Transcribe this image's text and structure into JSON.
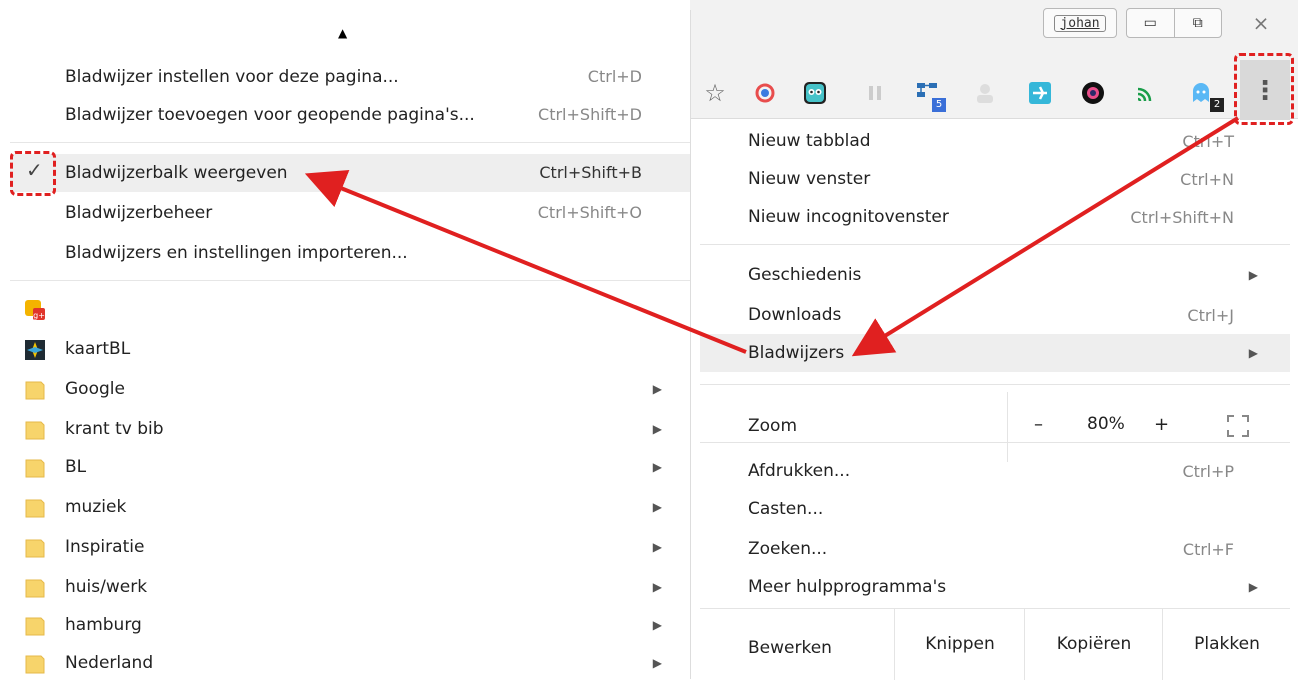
{
  "window": {
    "user_label": "johan",
    "minimize_symbol": "▭",
    "restore_symbol": "⧉",
    "close_symbol": "⨯"
  },
  "toolbar": {
    "star_symbol": "☆",
    "menu_symbol": "⋮",
    "extensions": [
      {
        "name": "b-icon",
        "badge": ""
      },
      {
        "name": "mask-icon",
        "badge": ""
      },
      {
        "name": "pause-icon",
        "badge": ""
      },
      {
        "name": "diagram-icon",
        "badge": "5"
      },
      {
        "name": "person-icon",
        "badge": ""
      },
      {
        "name": "plane-icon",
        "badge": ""
      },
      {
        "name": "camera-icon",
        "badge": ""
      },
      {
        "name": "cast-icon",
        "badge": ""
      },
      {
        "name": "ghost-icon",
        "badge": "2"
      }
    ]
  },
  "chrome_menu": {
    "new_tab": {
      "label": "Nieuw tabblad",
      "shortcut": "Ctrl+T"
    },
    "new_window": {
      "label": "Nieuw venster",
      "shortcut": "Ctrl+N"
    },
    "incognito": {
      "label": "Nieuw incognitovenster",
      "shortcut": "Ctrl+Shift+N"
    },
    "history": {
      "label": "Geschiedenis"
    },
    "downloads": {
      "label": "Downloads",
      "shortcut": "Ctrl+J"
    },
    "bookmarks": {
      "label": "Bladwijzers"
    },
    "zoom": {
      "label": "Zoom",
      "minus": "–",
      "value": "80%",
      "plus": "+"
    },
    "print": {
      "label": "Afdrukken...",
      "shortcut": "Ctrl+P"
    },
    "cast": {
      "label": "Casten..."
    },
    "find": {
      "label": "Zoeken...",
      "shortcut": "Ctrl+F"
    },
    "more_tools": {
      "label": "Meer hulpprogramma's"
    },
    "edit": {
      "label": "Bewerken",
      "cut": "Knippen",
      "copy": "Kopiëren",
      "paste": "Plakken"
    }
  },
  "bookmarks_menu": {
    "scroll_up": "▲",
    "bookmark_page": {
      "label": "Bladwijzer instellen voor deze pagina...",
      "shortcut": "Ctrl+D"
    },
    "bookmark_all": {
      "label": "Bladwijzer toevoegen voor geopende pagina's...",
      "shortcut": "Ctrl+Shift+D"
    },
    "show_bar": {
      "label": "Bladwijzerbalk weergeven",
      "shortcut": "Ctrl+Shift+B",
      "check": "✓"
    },
    "manager": {
      "label": "Bladwijzerbeheer",
      "shortcut": "Ctrl+Shift+O"
    },
    "import": {
      "label": "Bladwijzers en instellingen importeren..."
    },
    "kaart": {
      "label": "kaartBL"
    },
    "folders": [
      "Google",
      "krant tv bib",
      "BL",
      "muziek",
      "Inspiratie",
      "huis/werk",
      "hamburg",
      "Nederland"
    ],
    "submenu_arrow": "▶"
  },
  "colors": {
    "accent_red": "#e02020",
    "folder": "#f7d46b",
    "highlight": "#eeeeee"
  }
}
